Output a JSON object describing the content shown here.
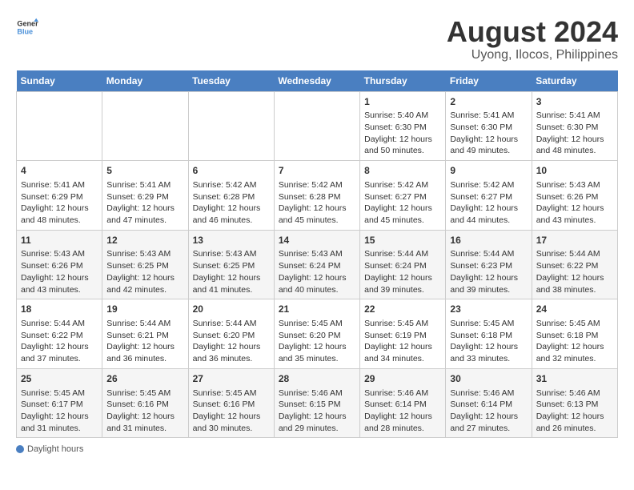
{
  "header": {
    "logo_line1": "General",
    "logo_line2": "Blue",
    "title": "August 2024",
    "subtitle": "Uyong, Ilocos, Philippines"
  },
  "days_of_week": [
    "Sunday",
    "Monday",
    "Tuesday",
    "Wednesday",
    "Thursday",
    "Friday",
    "Saturday"
  ],
  "weeks": [
    [
      {
        "day": "",
        "sunrise": "",
        "sunset": "",
        "daylight": ""
      },
      {
        "day": "",
        "sunrise": "",
        "sunset": "",
        "daylight": ""
      },
      {
        "day": "",
        "sunrise": "",
        "sunset": "",
        "daylight": ""
      },
      {
        "day": "",
        "sunrise": "",
        "sunset": "",
        "daylight": ""
      },
      {
        "day": "1",
        "sunrise": "Sunrise: 5:40 AM",
        "sunset": "Sunset: 6:30 PM",
        "daylight": "Daylight: 12 hours and 50 minutes."
      },
      {
        "day": "2",
        "sunrise": "Sunrise: 5:41 AM",
        "sunset": "Sunset: 6:30 PM",
        "daylight": "Daylight: 12 hours and 49 minutes."
      },
      {
        "day": "3",
        "sunrise": "Sunrise: 5:41 AM",
        "sunset": "Sunset: 6:30 PM",
        "daylight": "Daylight: 12 hours and 48 minutes."
      }
    ],
    [
      {
        "day": "4",
        "sunrise": "Sunrise: 5:41 AM",
        "sunset": "Sunset: 6:29 PM",
        "daylight": "Daylight: 12 hours and 48 minutes."
      },
      {
        "day": "5",
        "sunrise": "Sunrise: 5:41 AM",
        "sunset": "Sunset: 6:29 PM",
        "daylight": "Daylight: 12 hours and 47 minutes."
      },
      {
        "day": "6",
        "sunrise": "Sunrise: 5:42 AM",
        "sunset": "Sunset: 6:28 PM",
        "daylight": "Daylight: 12 hours and 46 minutes."
      },
      {
        "day": "7",
        "sunrise": "Sunrise: 5:42 AM",
        "sunset": "Sunset: 6:28 PM",
        "daylight": "Daylight: 12 hours and 45 minutes."
      },
      {
        "day": "8",
        "sunrise": "Sunrise: 5:42 AM",
        "sunset": "Sunset: 6:27 PM",
        "daylight": "Daylight: 12 hours and 45 minutes."
      },
      {
        "day": "9",
        "sunrise": "Sunrise: 5:42 AM",
        "sunset": "Sunset: 6:27 PM",
        "daylight": "Daylight: 12 hours and 44 minutes."
      },
      {
        "day": "10",
        "sunrise": "Sunrise: 5:43 AM",
        "sunset": "Sunset: 6:26 PM",
        "daylight": "Daylight: 12 hours and 43 minutes."
      }
    ],
    [
      {
        "day": "11",
        "sunrise": "Sunrise: 5:43 AM",
        "sunset": "Sunset: 6:26 PM",
        "daylight": "Daylight: 12 hours and 43 minutes."
      },
      {
        "day": "12",
        "sunrise": "Sunrise: 5:43 AM",
        "sunset": "Sunset: 6:25 PM",
        "daylight": "Daylight: 12 hours and 42 minutes."
      },
      {
        "day": "13",
        "sunrise": "Sunrise: 5:43 AM",
        "sunset": "Sunset: 6:25 PM",
        "daylight": "Daylight: 12 hours and 41 minutes."
      },
      {
        "day": "14",
        "sunrise": "Sunrise: 5:43 AM",
        "sunset": "Sunset: 6:24 PM",
        "daylight": "Daylight: 12 hours and 40 minutes."
      },
      {
        "day": "15",
        "sunrise": "Sunrise: 5:44 AM",
        "sunset": "Sunset: 6:24 PM",
        "daylight": "Daylight: 12 hours and 39 minutes."
      },
      {
        "day": "16",
        "sunrise": "Sunrise: 5:44 AM",
        "sunset": "Sunset: 6:23 PM",
        "daylight": "Daylight: 12 hours and 39 minutes."
      },
      {
        "day": "17",
        "sunrise": "Sunrise: 5:44 AM",
        "sunset": "Sunset: 6:22 PM",
        "daylight": "Daylight: 12 hours and 38 minutes."
      }
    ],
    [
      {
        "day": "18",
        "sunrise": "Sunrise: 5:44 AM",
        "sunset": "Sunset: 6:22 PM",
        "daylight": "Daylight: 12 hours and 37 minutes."
      },
      {
        "day": "19",
        "sunrise": "Sunrise: 5:44 AM",
        "sunset": "Sunset: 6:21 PM",
        "daylight": "Daylight: 12 hours and 36 minutes."
      },
      {
        "day": "20",
        "sunrise": "Sunrise: 5:44 AM",
        "sunset": "Sunset: 6:20 PM",
        "daylight": "Daylight: 12 hours and 36 minutes."
      },
      {
        "day": "21",
        "sunrise": "Sunrise: 5:45 AM",
        "sunset": "Sunset: 6:20 PM",
        "daylight": "Daylight: 12 hours and 35 minutes."
      },
      {
        "day": "22",
        "sunrise": "Sunrise: 5:45 AM",
        "sunset": "Sunset: 6:19 PM",
        "daylight": "Daylight: 12 hours and 34 minutes."
      },
      {
        "day": "23",
        "sunrise": "Sunrise: 5:45 AM",
        "sunset": "Sunset: 6:18 PM",
        "daylight": "Daylight: 12 hours and 33 minutes."
      },
      {
        "day": "24",
        "sunrise": "Sunrise: 5:45 AM",
        "sunset": "Sunset: 6:18 PM",
        "daylight": "Daylight: 12 hours and 32 minutes."
      }
    ],
    [
      {
        "day": "25",
        "sunrise": "Sunrise: 5:45 AM",
        "sunset": "Sunset: 6:17 PM",
        "daylight": "Daylight: 12 hours and 31 minutes."
      },
      {
        "day": "26",
        "sunrise": "Sunrise: 5:45 AM",
        "sunset": "Sunset: 6:16 PM",
        "daylight": "Daylight: 12 hours and 31 minutes."
      },
      {
        "day": "27",
        "sunrise": "Sunrise: 5:45 AM",
        "sunset": "Sunset: 6:16 PM",
        "daylight": "Daylight: 12 hours and 30 minutes."
      },
      {
        "day": "28",
        "sunrise": "Sunrise: 5:46 AM",
        "sunset": "Sunset: 6:15 PM",
        "daylight": "Daylight: 12 hours and 29 minutes."
      },
      {
        "day": "29",
        "sunrise": "Sunrise: 5:46 AM",
        "sunset": "Sunset: 6:14 PM",
        "daylight": "Daylight: 12 hours and 28 minutes."
      },
      {
        "day": "30",
        "sunrise": "Sunrise: 5:46 AM",
        "sunset": "Sunset: 6:14 PM",
        "daylight": "Daylight: 12 hours and 27 minutes."
      },
      {
        "day": "31",
        "sunrise": "Sunrise: 5:46 AM",
        "sunset": "Sunset: 6:13 PM",
        "daylight": "Daylight: 12 hours and 26 minutes."
      }
    ]
  ],
  "legend": {
    "daylight_label": "Daylight hours"
  }
}
